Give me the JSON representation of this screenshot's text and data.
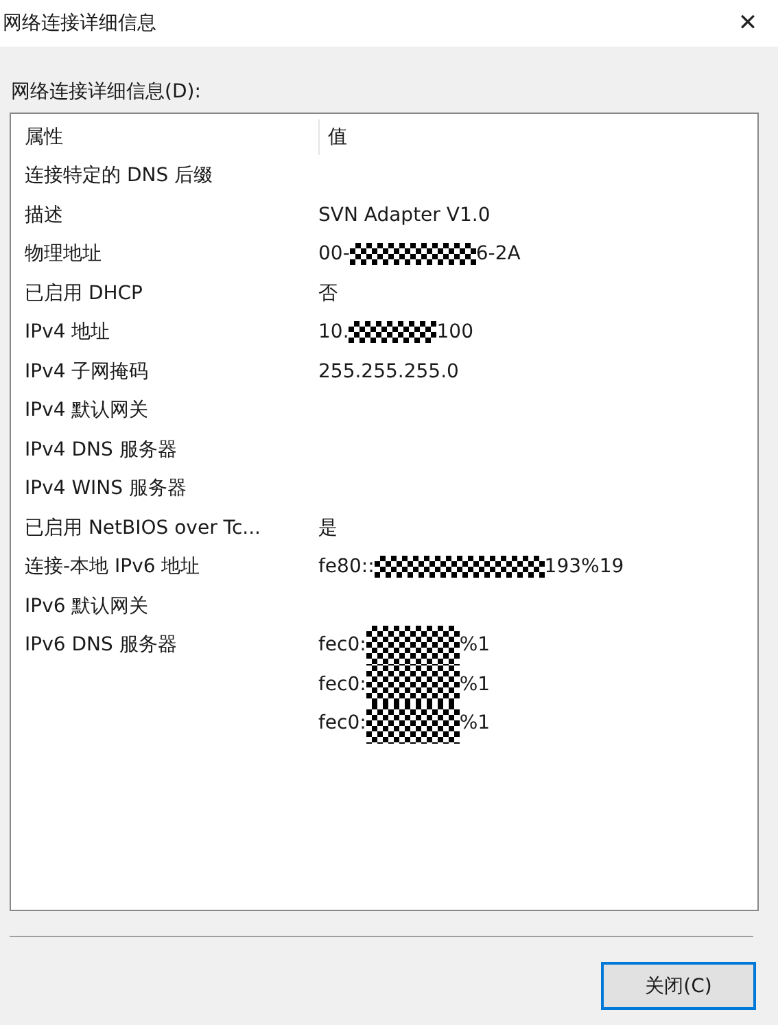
{
  "window": {
    "title": "网络连接详细信息",
    "close": "✕"
  },
  "label": "网络连接详细信息(D):",
  "table": {
    "columns": [
      "属性",
      "值"
    ],
    "rows": [
      {
        "property": "连接特定的 DNS 后缀",
        "values": []
      },
      {
        "property": "描述",
        "values": [
          {
            "prefix": "SVN Adapter V1.0"
          }
        ]
      },
      {
        "property": "物理地址",
        "values": [
          {
            "prefix": "00-",
            "kind": "mac",
            "suffix": "6-2A"
          }
        ]
      },
      {
        "property": "已启用 DHCP",
        "values": [
          {
            "prefix": "否"
          }
        ]
      },
      {
        "property": "IPv4 地址",
        "values": [
          {
            "prefix": "10.",
            "kind": "ipv4",
            "suffix": "100"
          }
        ]
      },
      {
        "property": "IPv4 子网掩码",
        "values": [
          {
            "prefix": "255.255.255.0"
          }
        ]
      },
      {
        "property": "IPv4 默认网关",
        "values": []
      },
      {
        "property": "IPv4 DNS 服务器",
        "values": []
      },
      {
        "property": "IPv4 WINS 服务器",
        "values": []
      },
      {
        "property": "已启用 NetBIOS over Tc...",
        "values": [
          {
            "prefix": "是"
          }
        ]
      },
      {
        "property": "连接-本地 IPv6 地址",
        "values": [
          {
            "prefix": "fe80::",
            "kind": "ipv6",
            "suffix": "193%19"
          }
        ]
      },
      {
        "property": "IPv6 默认网关",
        "values": []
      },
      {
        "property": "IPv6 DNS 服务器",
        "values": [
          {
            "prefix": "fec0:",
            "kind": "dns",
            "suffix": "%1"
          },
          {
            "prefix": "fec0:",
            "kind": "dns",
            "suffix": "%1"
          },
          {
            "prefix": "fec0:",
            "kind": "dns",
            "suffix": "%1"
          }
        ]
      }
    ]
  },
  "buttons": [
    {
      "label": "关闭(C)",
      "focused": true
    }
  ]
}
